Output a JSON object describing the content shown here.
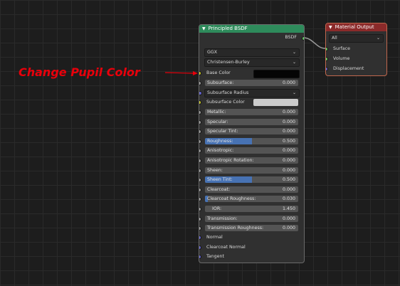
{
  "annotation": {
    "text": "Change Pupil Color",
    "color": "#e8000b"
  },
  "principled": {
    "title": "Principled BSDF",
    "output_label": "BSDF",
    "distribution": "GGX",
    "subsurface_method": "Christensen-Burley",
    "base_color": {
      "label": "Base Color",
      "value": "#050505"
    },
    "subsurface": {
      "label": "Subsurface:",
      "value": "0.000",
      "fraction": 0
    },
    "subsurface_radius": {
      "label": "Subsurface Radius"
    },
    "subsurface_color": {
      "label": "Subsurface Color",
      "value": "#cccccc"
    },
    "sliders": [
      {
        "label": "Metallic:",
        "value": "0.000",
        "fraction": 0
      },
      {
        "label": "Specular:",
        "value": "0.000",
        "fraction": 0
      },
      {
        "label": "Specular Tint:",
        "value": "0.000",
        "fraction": 0
      },
      {
        "label": "Roughness:",
        "value": "0.500",
        "fraction": 0.5
      },
      {
        "label": "Anisotropic:",
        "value": "0.000",
        "fraction": 0
      },
      {
        "label": "Anisotropic Rotation:",
        "value": "0.000",
        "fraction": 0
      },
      {
        "label": "Sheen:",
        "value": "0.000",
        "fraction": 0
      },
      {
        "label": "Sheen Tint:",
        "value": "0.500",
        "fraction": 0.5
      },
      {
        "label": "Clearcoat:",
        "value": "0.000",
        "fraction": 0
      },
      {
        "label": "Clearcoat Roughness:",
        "value": "0.030",
        "fraction": 0.03
      },
      {
        "label": "IOR:",
        "value": "1.450",
        "fraction": 0
      },
      {
        "label": "Transmission:",
        "value": "0.000",
        "fraction": 0
      },
      {
        "label": "Transmission Roughness:",
        "value": "0.000",
        "fraction": 0
      }
    ],
    "vector_inputs": [
      "Normal",
      "Clearcoat Normal",
      "Tangent"
    ]
  },
  "output": {
    "title": "Material Output",
    "target": "All",
    "inputs": [
      "Surface",
      "Volume",
      "Displacement"
    ]
  }
}
